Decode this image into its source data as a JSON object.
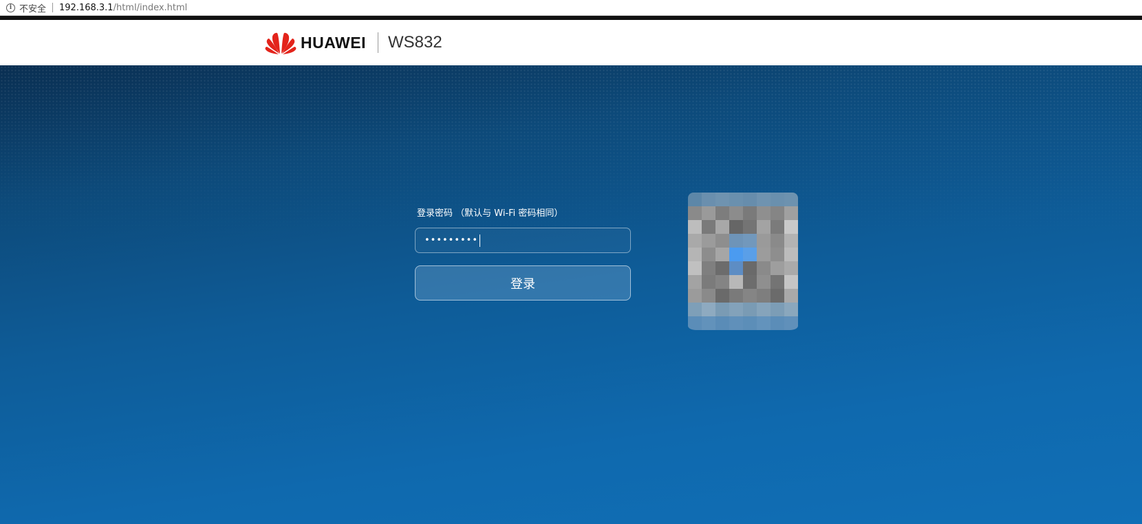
{
  "browser": {
    "security_label": "不安全",
    "url_host": "192.168.3.1",
    "url_path": "/html/index.html"
  },
  "header": {
    "brand": "HUAWEI",
    "model": "WS832",
    "brand_color": "#e3241b"
  },
  "login": {
    "password_label": "登录密码 （默认与 Wi-Fi 密码相同）",
    "password_value": "•••••••••",
    "submit_label": "登录"
  },
  "colors": {
    "background_top": "#0a2f52",
    "background_bottom": "#106fb6",
    "accent_white": "#ffffff"
  }
}
